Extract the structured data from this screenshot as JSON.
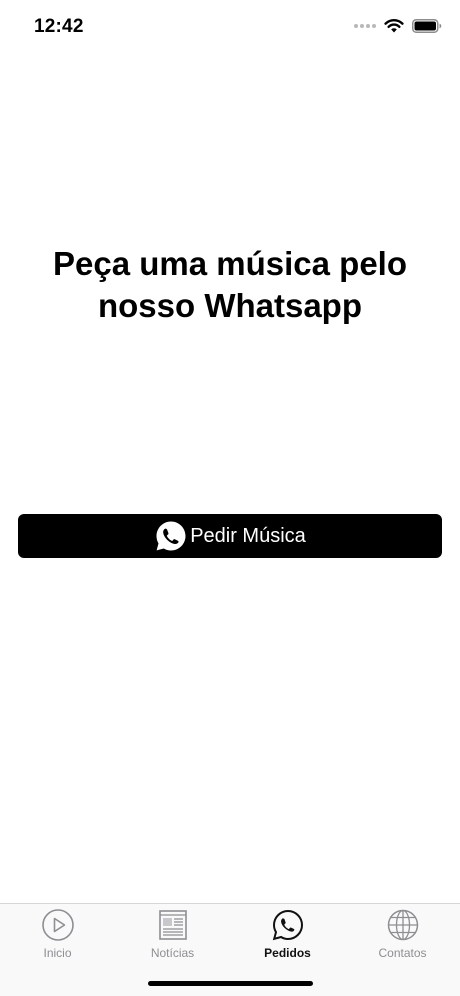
{
  "status_bar": {
    "time": "12:42",
    "icons": [
      "signal-dots-icon",
      "wifi-icon",
      "battery-icon"
    ]
  },
  "main": {
    "headline_line1": "Peça uma música pelo",
    "headline_line2": "nosso Whatsapp",
    "order_button": {
      "label": "Pedir Música",
      "icon": "whatsapp-icon",
      "background": "#000000",
      "text_color": "#ffffff"
    }
  },
  "tab_bar": {
    "active_tab": "Pedidos",
    "active_color": "#111111",
    "inactive_color": "#8e8e93",
    "tabs": [
      {
        "label": "Inicio",
        "icon": "play-circle-icon"
      },
      {
        "label": "Notícias",
        "icon": "newspaper-icon"
      },
      {
        "label": "Pedidos",
        "icon": "whatsapp-icon"
      },
      {
        "label": "Contatos",
        "icon": "globe-icon"
      }
    ]
  }
}
